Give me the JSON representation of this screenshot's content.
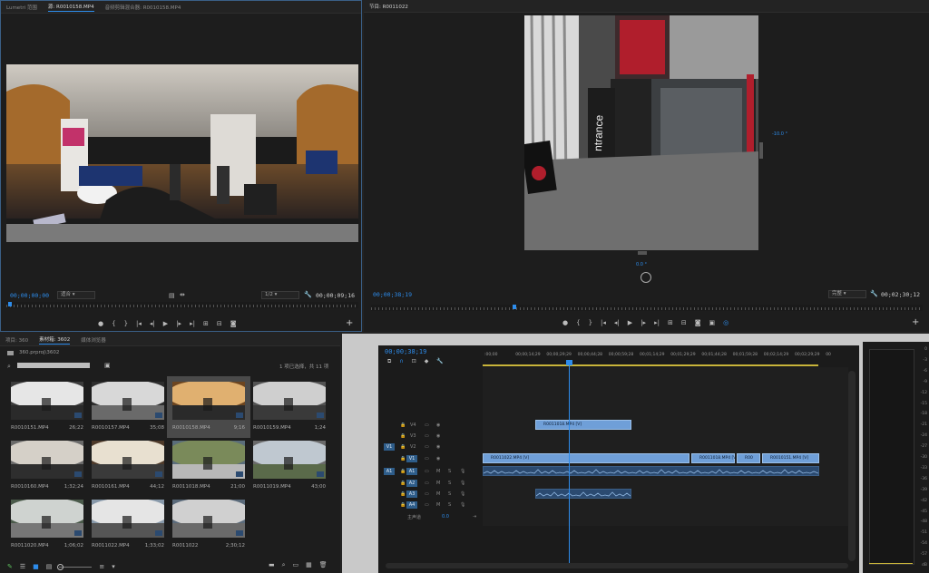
{
  "source_monitor": {
    "tabs": [
      "Lumetri 范围",
      "源: R0010158.MP4",
      "音频剪辑混合器: R0010158.MP4"
    ],
    "timecode_in": "00;00;00;00",
    "fit": "适合",
    "resolution": "1/2",
    "duration": "00;00;09;16"
  },
  "program_monitor": {
    "title": "节目: R0011022",
    "timecode": "00;00;38;19",
    "fit": "完整",
    "duration": "00;02;30;12",
    "pitch_label": "-10.0 °",
    "yaw_label": "0.0 °",
    "overlay_label": "ntrance"
  },
  "project": {
    "tabs": [
      "项目: 360",
      "素材箱: 3602",
      "媒体浏览器"
    ],
    "path": "360.prproj\\3602",
    "search_placeholder": "",
    "selection_info": "1 项已选择，共 11 项",
    "items": [
      {
        "name": "R0010151.MP4",
        "duration": "26;22"
      },
      {
        "name": "R0010157.MP4",
        "duration": "35;08"
      },
      {
        "name": "R0010158.MP4",
        "duration": "9;16"
      },
      {
        "name": "R0010159.MP4",
        "duration": "1;24"
      },
      {
        "name": "R0010160.MP4",
        "duration": "1;32;24"
      },
      {
        "name": "R0010161.MP4",
        "duration": "44;12"
      },
      {
        "name": "R0011018.MP4",
        "duration": "21;00"
      },
      {
        "name": "R0011019.MP4",
        "duration": "43;00"
      },
      {
        "name": "R0011020.MP4",
        "duration": "1;06;02"
      },
      {
        "name": "R0011022.MP4",
        "duration": "1;33;02"
      },
      {
        "name": "R0011022",
        "duration": "2;30;12"
      }
    ]
  },
  "timeline": {
    "timecode": "00;00;38;19",
    "ruler": [
      ":00;00",
      "00;00;14;29",
      "00;00;29;29",
      "00;00;44;28",
      "00;00;59;28",
      "00;01;14;29",
      "00;01;29;29",
      "00;01;44;28",
      "00;01;59;28",
      "00;02;14;29",
      "00;02;29;29",
      "00"
    ],
    "video_tracks": [
      "V4",
      "V3",
      "V2",
      "V1"
    ],
    "audio_tracks": [
      "A1",
      "A2",
      "A3",
      "A4"
    ],
    "patch_v": "V1",
    "patch_a": "A1",
    "master_label": "主声道",
    "master_value": "0.0",
    "clips": {
      "v4": "R0011018.MP4 [V]",
      "v1a": "R0011022.MP4 [V]",
      "v1b": "R0011018.MP4 [V]",
      "v1c": "R00",
      "v1d": "R0010151.MP4 [V]"
    },
    "mute": "M",
    "solo": "S"
  },
  "meters": [
    "0",
    "-3",
    "-6",
    "-9",
    "-12",
    "-15",
    "-18",
    "-21",
    "-24",
    "-27",
    "-30",
    "-33",
    "-36",
    "-39",
    "-42",
    "-45",
    "-48",
    "-51",
    "-54",
    "-57",
    "dB"
  ],
  "colors": {
    "accent": "#2d8ceb",
    "clip_video": "#6f9fd8",
    "clip_audio": "#2b4a70"
  }
}
